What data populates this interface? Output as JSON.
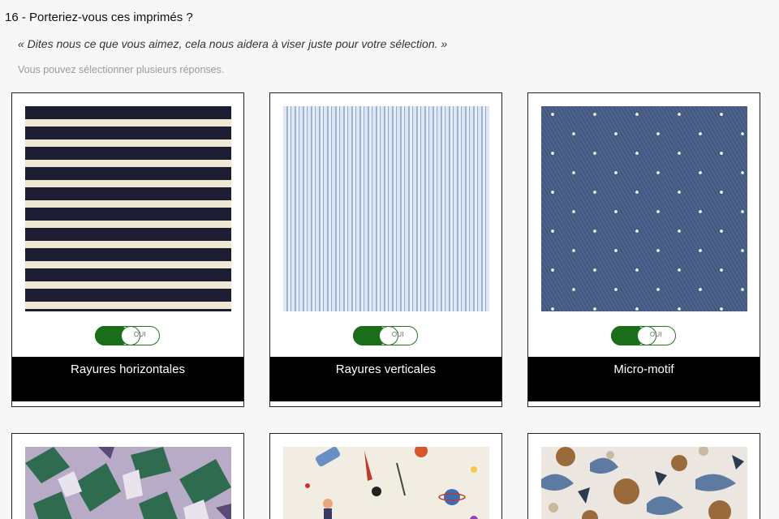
{
  "question": {
    "number": "16",
    "title": "16 - Porteriez-vous ces imprimés ?",
    "subtitle": "« Dites nous ce que vous aimez, cela nous aidera à viser juste pour votre sélection. »",
    "hint": "Vous pouvez sélectionner plusieurs réponses."
  },
  "options": [
    {
      "label": "Rayures horizontales",
      "toggle": "OUI",
      "pattern": "horizontal-stripes"
    },
    {
      "label": "Rayures verticales",
      "toggle": "OUI",
      "pattern": "vertical-stripes"
    },
    {
      "label": "Micro-motif",
      "toggle": "OUI",
      "pattern": "micro-dots"
    },
    {
      "pattern": "leaf-print"
    },
    {
      "pattern": "space-print"
    },
    {
      "pattern": "floral-print"
    }
  ],
  "colors": {
    "toggle_on": "#1a6e1a",
    "label_bar": "#000000"
  }
}
